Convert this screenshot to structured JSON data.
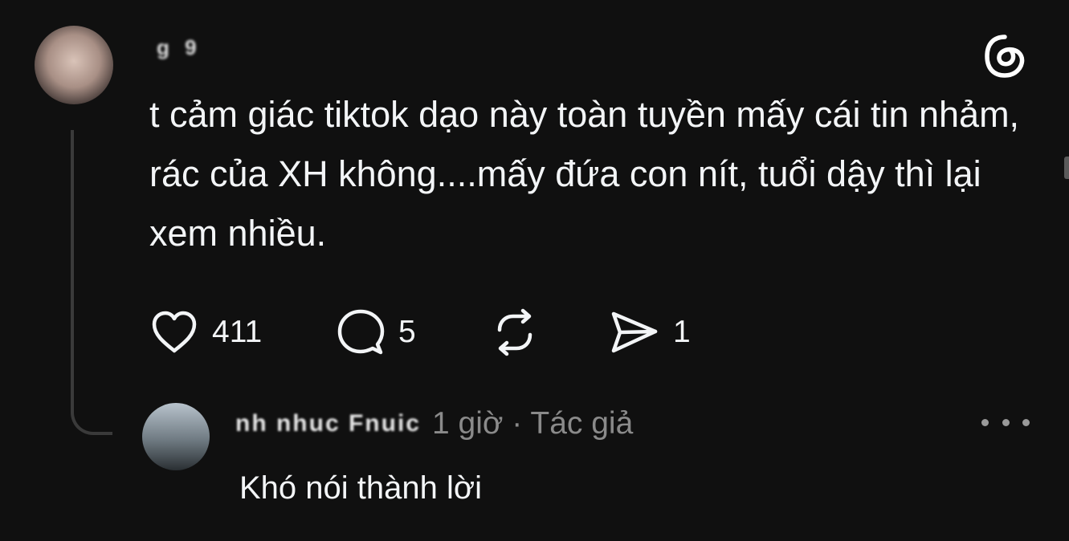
{
  "post": {
    "username": "g          9",
    "text": "t cảm giác tiktok dạo này toàn tuyền mấy cái tin nhảm, rác của XH không....mấy đứa con nít, tuổi dậy thì lại xem nhiều.",
    "actions": {
      "like_count": "411",
      "comment_count": "5",
      "share_count": "1"
    }
  },
  "reply": {
    "username": "nh    nhuc  Fnuic",
    "time_label": "1 giờ · Tác giả",
    "text": "Khó nói thành lời"
  },
  "icons": {
    "logo": "threads-logo-icon",
    "like": "heart-icon",
    "comment": "comment-bubble-icon",
    "repost": "repost-icon",
    "share": "send-icon",
    "more": "more-dots-icon"
  },
  "colors": {
    "background": "#101010",
    "text": "#f3f5f7",
    "muted": "#8a8a8a",
    "thread_line": "#3a3a3a"
  }
}
